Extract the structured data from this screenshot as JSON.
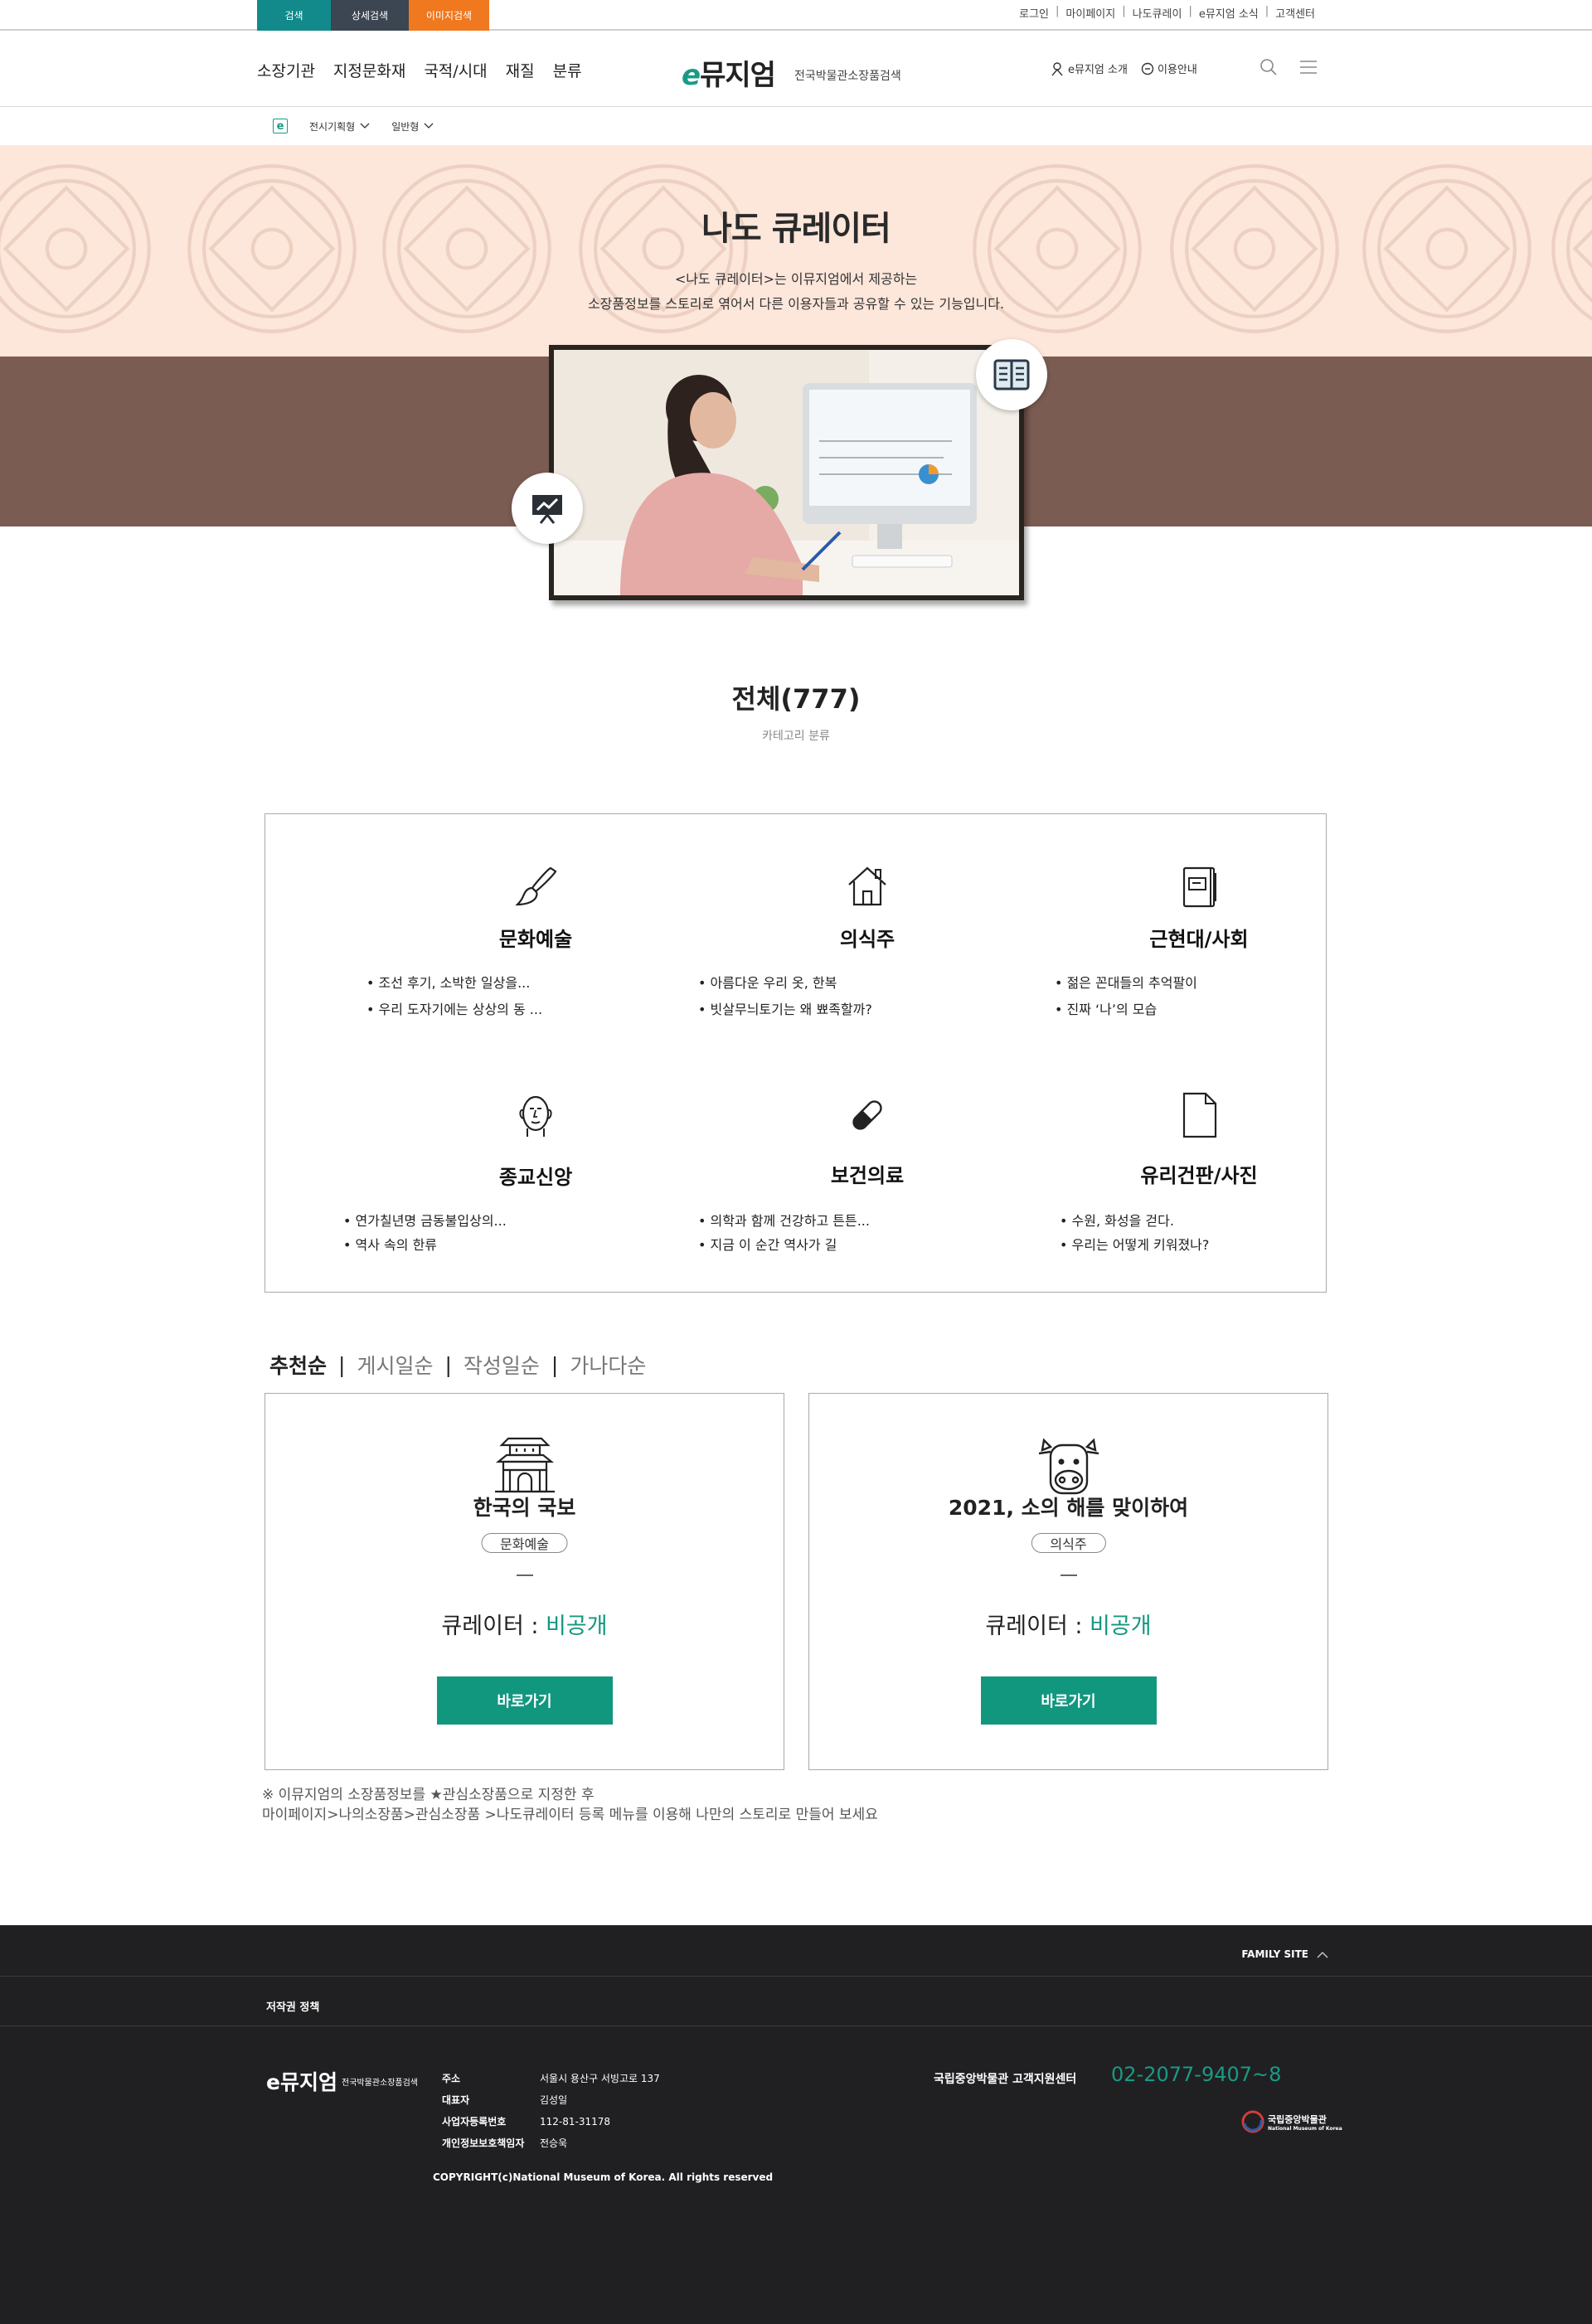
{
  "topbar": {
    "tabs": [
      {
        "label": "검색",
        "color": "#12898b"
      },
      {
        "label": "상세검색",
        "color": "#3c4652"
      },
      {
        "label": "이미지검색",
        "color": "#f0781e"
      }
    ],
    "links": [
      "로그인",
      "마이페이지",
      "나도큐레이",
      "e뮤지엄 소식",
      "고객센터"
    ]
  },
  "header": {
    "gnb": [
      "소장기관",
      "지정문화재",
      "국적/시대",
      "재질",
      "분류"
    ],
    "logo": {
      "e": "e",
      "text": "뮤지엄"
    },
    "logo_sub": "전국박물관소장품검색",
    "util": [
      "e뮤지엄 소개",
      "이용안내"
    ]
  },
  "subnav": {
    "badge": "e",
    "items": [
      "전시기획형",
      "일반형"
    ]
  },
  "hero": {
    "title": "나도 큐레이터",
    "desc1": "<나도 큐레이터>는 이뮤지엄에서 제공하는",
    "desc2": "소장품정보를 스토리로 엮어서 다른 이용자들과 공유할 수 있는 기능입니다."
  },
  "summary": {
    "total": "전체(777)",
    "sub": "카테고리 분류"
  },
  "categories": [
    {
      "name": "문화예술",
      "icon": "paintbrush-icon",
      "items": [
        "조선 후기, 소박한 일상을...",
        "우리 도자기에는 상상의 동 ..."
      ]
    },
    {
      "name": "의식주",
      "icon": "house-icon",
      "items": [
        "아름다운 우리 옷, 한복",
        "빗살무늬토기는 왜 뾰족할까?"
      ]
    },
    {
      "name": "근현대/사회",
      "icon": "notebook-icon",
      "items": [
        "젊은 꼰대들의 추억팔이",
        "진짜 ‘나’의 모습"
      ]
    },
    {
      "name": "종교신앙",
      "icon": "buddha-face-icon",
      "items": [
        "연가칠년명 금동불입상의...",
        "역사 속의 한류"
      ]
    },
    {
      "name": "보건의료",
      "icon": "pill-icon",
      "items": [
        "의학과 함께 건강하고 튼튼...",
        "지금 이 순간 역사가 길"
      ]
    },
    {
      "name": "유리건판/사진",
      "icon": "document-icon",
      "items": [
        "수원, 화성을 걷다.",
        "우리는 어떻게 키워졌나?"
      ]
    }
  ],
  "sort": [
    "추천순",
    "게시일순",
    "작성일순",
    "가나다순"
  ],
  "cards": [
    {
      "title": "한국의 국보",
      "tag": "문화예술",
      "curator_label": "큐레이터 : ",
      "curator_value": "비공개",
      "button": "바로가기",
      "icon": "palace-icon"
    },
    {
      "title": "2021, 소의 해를 맞이하여",
      "tag": "의식주",
      "curator_label": "큐레이터 : ",
      "curator_value": "비공개",
      "button": "바로가기",
      "icon": "cow-icon"
    }
  ],
  "notes": [
    "※ 이뮤지엄의 소장품정보를 ★관심소장품으로 지정한 후",
    "마이페이지>나의소장품>관심소장품 >나도큐레이터 등록 메뉴를 이용해 나만의 스토리로 만들어 보세요"
  ],
  "footer": {
    "family_site": "FAMILY SITE",
    "policy": "저작권 정책",
    "logo": "e뮤지엄",
    "logo_sub": "전국박물관소장품검색",
    "info": [
      {
        "k": "주소",
        "v": "서울시 용산구 서빙고로 137"
      },
      {
        "k": "대표자",
        "v": "김성일"
      },
      {
        "k": "사업자등록번호",
        "v": "112-81-31178"
      },
      {
        "k": "개인정보보호책임자",
        "v": "전승욱"
      }
    ],
    "copyright": "COPYRIGHT(c)National Museum of Korea. All rights reserved",
    "cs_label": "국립중앙박물관 고객지원센터",
    "phone": "02-2077-9407~8",
    "museum_logo": "국립중앙박물관",
    "museum_logo_en": "National Museum of Korea"
  },
  "colors": {
    "accent": "#12977f",
    "hero_top": "#fde6da",
    "hero_bottom": "#7b5c52",
    "footer": "#202022"
  }
}
